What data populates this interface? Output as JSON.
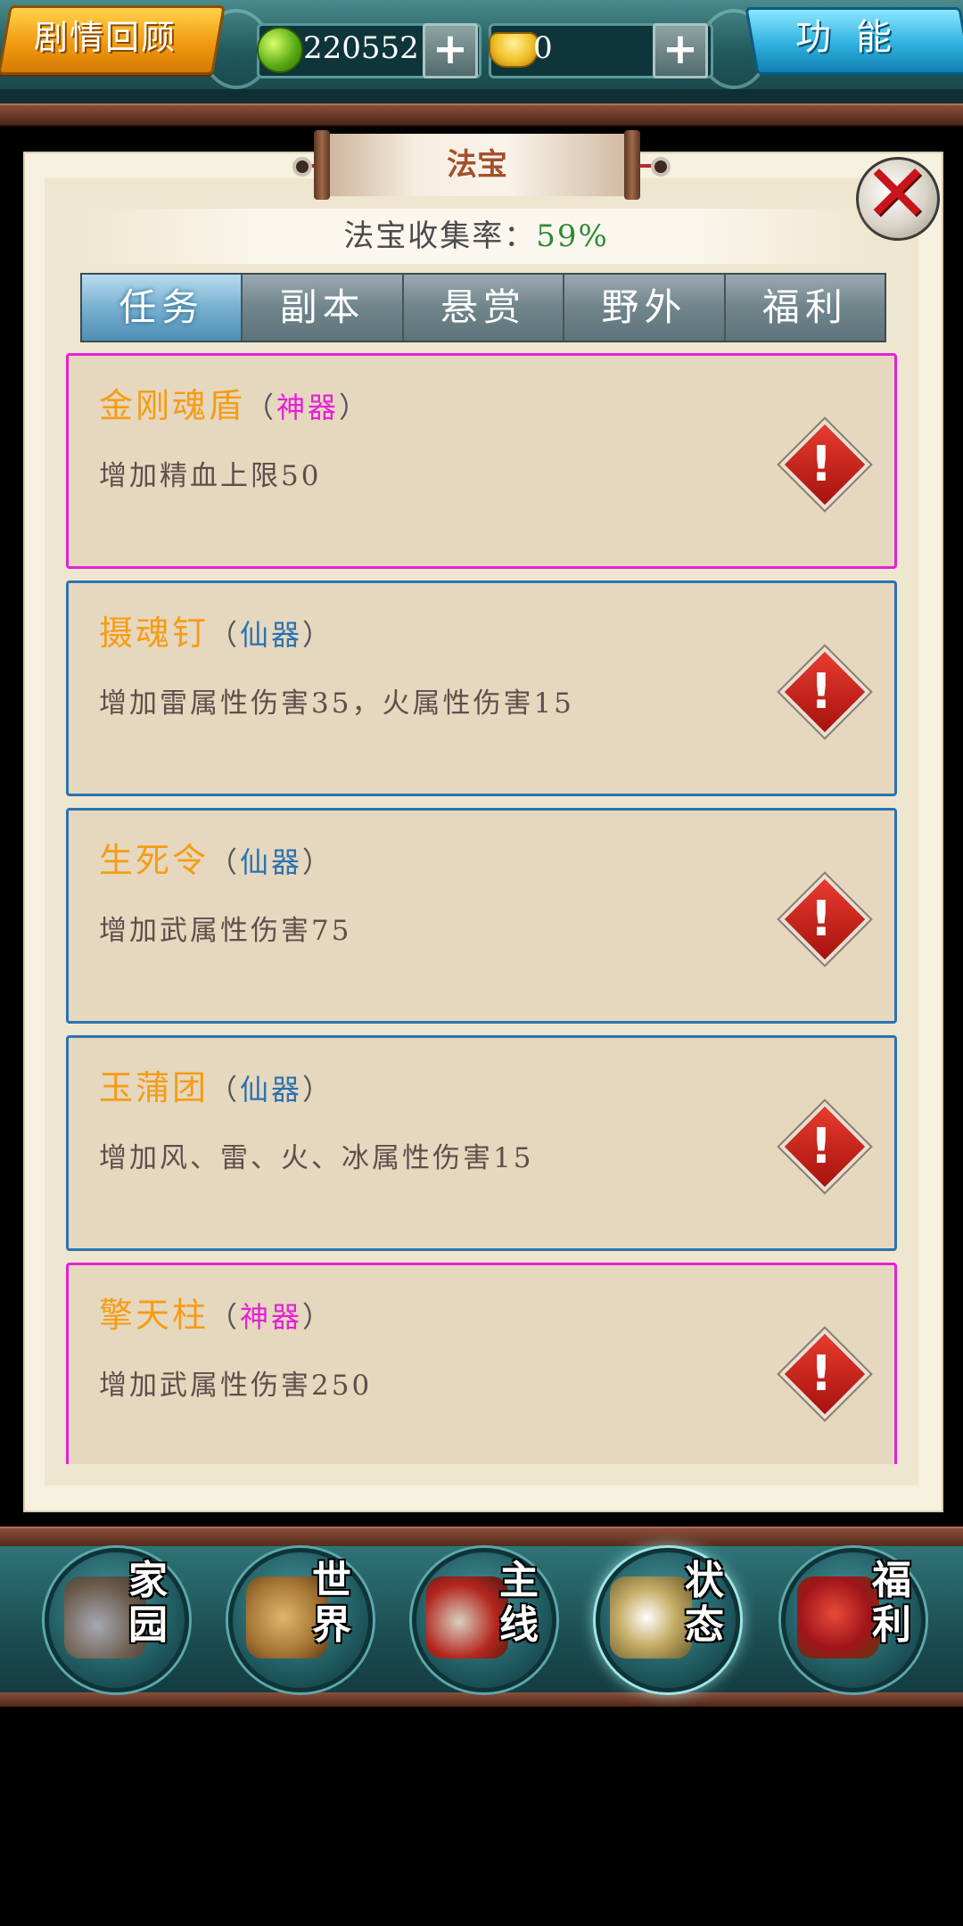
{
  "topbar": {
    "story_button": "剧情回顾",
    "jade_amount": "220552",
    "gold_amount": "0",
    "plus_label": "+",
    "function_button": "功能"
  },
  "panel": {
    "title": "法宝",
    "collection_label": "法宝收集率：",
    "collection_value": "59%",
    "tabs": [
      {
        "label": "任务",
        "active": true
      },
      {
        "label": "副本",
        "active": false
      },
      {
        "label": "悬赏",
        "active": false
      },
      {
        "label": "野外",
        "active": false
      },
      {
        "label": "福利",
        "active": false
      }
    ],
    "items": [
      {
        "name": "金刚魂盾",
        "grade_open": "（",
        "grade": "神器",
        "grade_close": "）",
        "grade_type": "divine",
        "desc": "增加精血上限50"
      },
      {
        "name": "摄魂钉",
        "grade_open": "（",
        "grade": "仙器",
        "grade_close": "）",
        "grade_type": "immortal",
        "desc": "增加雷属性伤害35，火属性伤害15"
      },
      {
        "name": "生死令",
        "grade_open": "（",
        "grade": "仙器",
        "grade_close": "）",
        "grade_type": "immortal",
        "desc": "增加武属性伤害75"
      },
      {
        "name": "玉蒲团",
        "grade_open": "（",
        "grade": "仙器",
        "grade_close": "）",
        "grade_type": "immortal",
        "desc": "增加风、雷、火、冰属性伤害15"
      },
      {
        "name": "擎天柱",
        "grade_open": "（",
        "grade": "神器",
        "grade_close": "）",
        "grade_type": "divine",
        "desc": "增加武属性伤害250"
      }
    ],
    "alert_glyph": "!",
    "close_glyph": "✕"
  },
  "bottom_nav": [
    {
      "label_top": "家",
      "label_bottom": "园",
      "icon": "home-icon"
    },
    {
      "label_top": "世",
      "label_bottom": "界",
      "icon": "world-map-icon"
    },
    {
      "label_top": "主",
      "label_bottom": "线",
      "icon": "main-quest-icon"
    },
    {
      "label_top": "状",
      "label_bottom": "态",
      "icon": "status-icon"
    },
    {
      "label_top": "福",
      "label_bottom": "利",
      "icon": "gift-bag-icon"
    }
  ],
  "colors": {
    "divine_border": "#e421d6",
    "immortal_border": "#2a73b2",
    "item_name": "#f59d14",
    "collection_value": "#2e8a38"
  }
}
